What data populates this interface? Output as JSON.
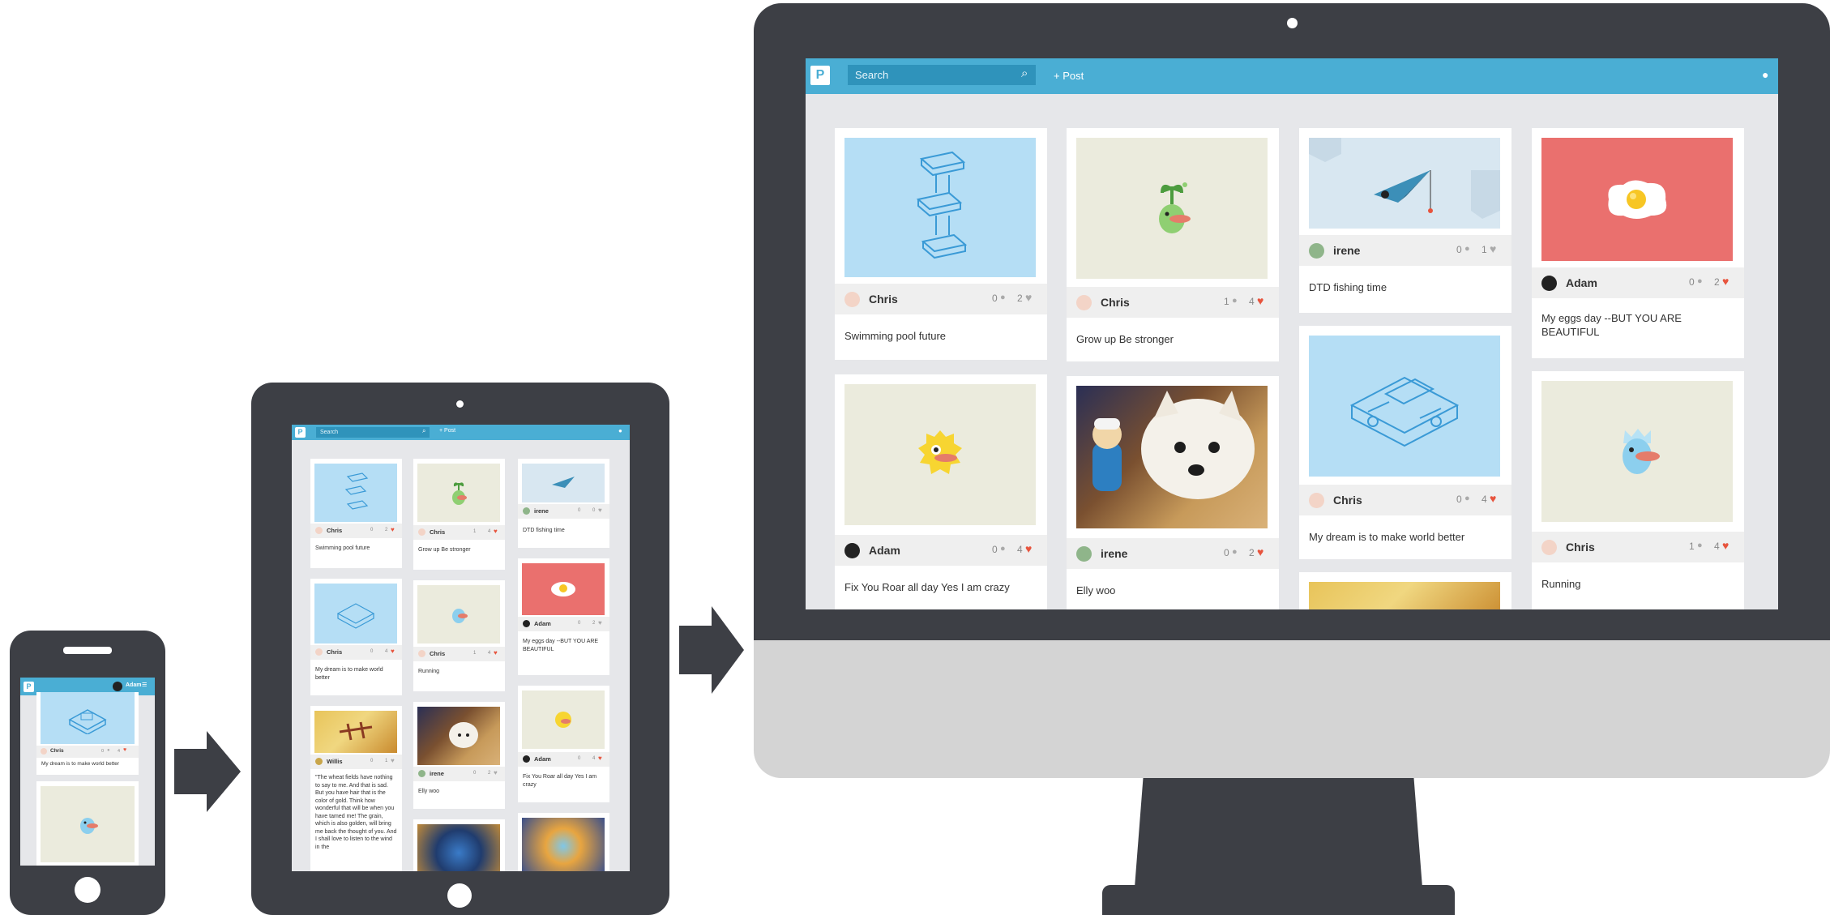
{
  "app": {
    "logo": "P",
    "search_placeholder": "Search",
    "post_label": "+ Post",
    "phone_user": "Adam"
  },
  "colors": {
    "accent": "#4aaed4",
    "device": "#3d3f45",
    "heart_active": "#e7543d",
    "screen_bg": "#e6e7ea"
  },
  "desktop": {
    "cards": [
      {
        "user": "Chris",
        "comments": "0",
        "likes": "2",
        "liked": false,
        "caption": "Swimming pool future",
        "image": "blueprint-tower"
      },
      {
        "user": "Chris",
        "comments": "1",
        "likes": "4",
        "liked": true,
        "caption": "Grow up Be stronger",
        "image": "sprout-creature"
      },
      {
        "user": "irene",
        "comments": "0",
        "likes": "1",
        "liked": false,
        "caption": "DTD fishing time",
        "image": "paper-plane-fishing"
      },
      {
        "user": "Adam",
        "comments": "0",
        "likes": "2",
        "liked": true,
        "caption": "My eggs day --BUT YOU ARE BEAUTIFUL",
        "image": "fried-egg"
      },
      {
        "user": "Adam",
        "comments": "0",
        "likes": "4",
        "liked": true,
        "caption": "Fix You Roar all day Yes I am crazy",
        "image": "yellow-monster"
      },
      {
        "user": "irene",
        "comments": "0",
        "likes": "2",
        "liked": true,
        "caption": "Elly woo",
        "image": "dog-photo"
      },
      {
        "user": "Chris",
        "comments": "0",
        "likes": "4",
        "liked": true,
        "caption": "My dream is to make world better",
        "image": "blueprint-machine"
      },
      {
        "user": "Chris",
        "comments": "1",
        "likes": "4",
        "liked": true,
        "caption": "Running",
        "image": "blue-creature"
      }
    ]
  },
  "tablet": {
    "cards": [
      {
        "user": "Chris",
        "comments": "0",
        "likes": "2",
        "liked": true,
        "caption": "Swimming pool future"
      },
      {
        "user": "Chris",
        "comments": "1",
        "likes": "4",
        "liked": true,
        "caption": "Grow up Be stronger"
      },
      {
        "user": "irene",
        "comments": "0",
        "likes": "0",
        "liked": false,
        "caption": "DTD fishing time"
      },
      {
        "user": "Chris",
        "comments": "0",
        "likes": "4",
        "liked": true,
        "caption": "My dream is to make world better"
      },
      {
        "user": "Chris",
        "comments": "1",
        "likes": "4",
        "liked": true,
        "caption": "Running"
      },
      {
        "user": "Adam",
        "comments": "0",
        "likes": "2",
        "liked": false,
        "caption": "My eggs day --BUT YOU ARE BEAUTIFUL"
      },
      {
        "user": "Willis",
        "comments": "0",
        "likes": "1",
        "liked": false,
        "caption": "\"The wheat fields have nothing to say to me. And that is sad. But you have hair that is the color of gold. Think how wonderful that will be when you have tamed me! The grain, which is also golden, will bring me back the thought of you. And I shall love to listen to the wind in the"
      },
      {
        "user": "irene",
        "comments": "0",
        "likes": "2",
        "liked": false,
        "caption": "Elly woo"
      },
      {
        "user": "Adam",
        "comments": "0",
        "likes": "4",
        "liked": true,
        "caption": "Fix You Roar all day Yes I am crazy"
      }
    ]
  },
  "phone": {
    "cards": [
      {
        "user": "Chris",
        "comments": "0",
        "likes": "4",
        "liked": true,
        "caption": "My dream is to make world better"
      }
    ]
  }
}
